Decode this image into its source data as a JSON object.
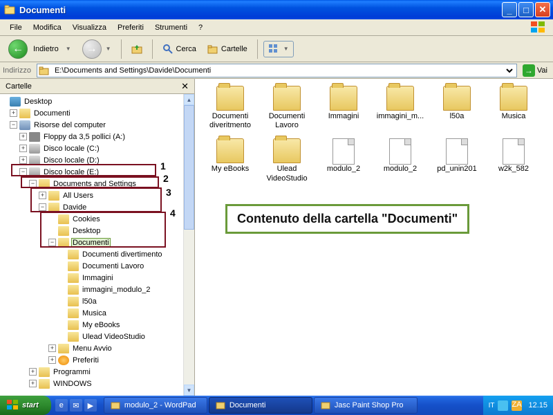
{
  "window": {
    "title": "Documenti"
  },
  "menu": [
    "File",
    "Modifica",
    "Visualizza",
    "Preferiti",
    "Strumenti",
    "?"
  ],
  "toolbar": {
    "back": "Indietro",
    "search": "Cerca",
    "folders": "Cartelle"
  },
  "address": {
    "label": "Indirizzo",
    "path": "E:\\Documents and Settings\\Davide\\Documenti",
    "go": "Vai"
  },
  "tree": {
    "header": "Cartelle",
    "items": [
      {
        "ind": 0,
        "tg": "",
        "ico": "desktop",
        "lbl": "Desktop"
      },
      {
        "ind": 1,
        "tg": "+",
        "ico": "folder",
        "lbl": "Documenti"
      },
      {
        "ind": 1,
        "tg": "-",
        "ico": "computer",
        "lbl": "Risorse del computer"
      },
      {
        "ind": 2,
        "tg": "+",
        "ico": "floppy",
        "lbl": "Floppy da 3,5 pollici (A:)"
      },
      {
        "ind": 2,
        "tg": "+",
        "ico": "drive",
        "lbl": "Disco locale (C:)"
      },
      {
        "ind": 2,
        "tg": "+",
        "ico": "drive",
        "lbl": "Disco locale (D:)"
      },
      {
        "ind": 2,
        "tg": "-",
        "ico": "drive",
        "lbl": "Disco locale (E:)"
      },
      {
        "ind": 3,
        "tg": "-",
        "ico": "folder",
        "lbl": "Documents and Settings"
      },
      {
        "ind": 4,
        "tg": "+",
        "ico": "folder",
        "lbl": "All Users"
      },
      {
        "ind": 4,
        "tg": "-",
        "ico": "folder",
        "lbl": "Davide"
      },
      {
        "ind": 5,
        "tg": "",
        "ico": "folder",
        "lbl": "Cookies"
      },
      {
        "ind": 5,
        "tg": "",
        "ico": "folder",
        "lbl": "Desktop"
      },
      {
        "ind": 5,
        "tg": "-",
        "ico": "folder",
        "lbl": "Documenti",
        "sel": true
      },
      {
        "ind": 6,
        "tg": "",
        "ico": "folder",
        "lbl": "Documenti divertimento"
      },
      {
        "ind": 6,
        "tg": "",
        "ico": "folder",
        "lbl": "Documenti Lavoro"
      },
      {
        "ind": 6,
        "tg": "",
        "ico": "folder",
        "lbl": "Immagini"
      },
      {
        "ind": 6,
        "tg": "",
        "ico": "folder",
        "lbl": "immagini_modulo_2"
      },
      {
        "ind": 6,
        "tg": "",
        "ico": "folder",
        "lbl": "l50a"
      },
      {
        "ind": 6,
        "tg": "",
        "ico": "folder",
        "lbl": "Musica"
      },
      {
        "ind": 6,
        "tg": "",
        "ico": "folder",
        "lbl": "My eBooks"
      },
      {
        "ind": 6,
        "tg": "",
        "ico": "folder",
        "lbl": "Ulead VideoStudio"
      },
      {
        "ind": 5,
        "tg": "+",
        "ico": "folder",
        "lbl": "Menu Avvio"
      },
      {
        "ind": 5,
        "tg": "+",
        "ico": "star",
        "lbl": "Preferiti"
      },
      {
        "ind": 3,
        "tg": "+",
        "ico": "folder",
        "lbl": "Programmi"
      },
      {
        "ind": 3,
        "tg": "+",
        "ico": "folder",
        "lbl": "WINDOWS"
      }
    ]
  },
  "annotations": {
    "n1": "1",
    "n2": "2",
    "n3": "3",
    "n4": "4"
  },
  "icons": [
    {
      "type": "folder",
      "label": "Documenti diveritmento"
    },
    {
      "type": "folder",
      "label": "Documenti Lavoro"
    },
    {
      "type": "folder",
      "label": "Immagini"
    },
    {
      "type": "folder",
      "label": "immagini_m..."
    },
    {
      "type": "folder",
      "label": "l50a"
    },
    {
      "type": "folder",
      "label": "Musica"
    },
    {
      "type": "folder",
      "label": "My eBooks"
    },
    {
      "type": "folder",
      "label": "Ulead VideoStudio"
    },
    {
      "type": "file",
      "label": "modulo_2"
    },
    {
      "type": "file",
      "label": "modulo_2"
    },
    {
      "type": "file",
      "label": "pd_unin201"
    },
    {
      "type": "file",
      "label": "w2k_582"
    }
  ],
  "callout": "Contenuto della cartella \"Documenti\"",
  "taskbar": {
    "start": "start",
    "tasks": [
      {
        "label": "modulo_2 - WordPad"
      },
      {
        "label": "Documenti",
        "active": true
      },
      {
        "label": "Jasc Paint Shop Pro"
      }
    ],
    "lang": "IT",
    "clock": "12.15"
  }
}
